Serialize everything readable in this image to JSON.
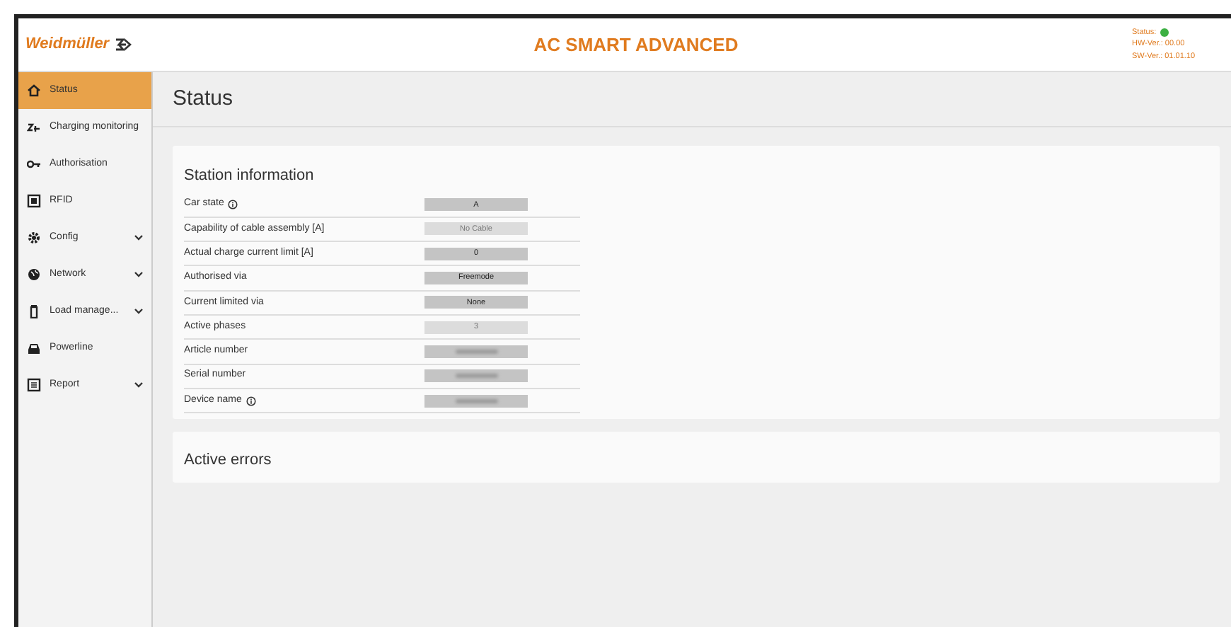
{
  "header": {
    "brand": "Weidmüller",
    "title": "AC SMART ADVANCED",
    "status_label": "Status:",
    "hw_version": "HW-Ver.: 00.00",
    "sw_version": "SW-Ver.: 01.01.10"
  },
  "sidebar": {
    "items": [
      {
        "label": "Status",
        "kind": "home",
        "selected": true,
        "expandable": false
      },
      {
        "label": "Charging monitoring",
        "kind": "plug",
        "selected": false,
        "expandable": false
      },
      {
        "label": "Authorisation",
        "kind": "key",
        "selected": false,
        "expandable": false
      },
      {
        "label": "RFID",
        "kind": "card",
        "selected": false,
        "expandable": false
      },
      {
        "label": "Config",
        "kind": "gear",
        "selected": false,
        "expandable": true
      },
      {
        "label": "Network",
        "kind": "globe",
        "selected": false,
        "expandable": true
      },
      {
        "label": "Load manage...",
        "kind": "pillar",
        "selected": false,
        "expandable": true
      },
      {
        "label": "Powerline",
        "kind": "car",
        "selected": false,
        "expandable": false
      },
      {
        "label": "Report",
        "kind": "report",
        "selected": false,
        "expandable": true
      }
    ]
  },
  "page_title": "Status",
  "station_information": {
    "title": "Station information",
    "rows": [
      {
        "label": "Car state",
        "info": true,
        "value": "A",
        "disabled": false
      },
      {
        "label": "Capability of cable assembly [A]",
        "info": false,
        "value": "No Cable",
        "disabled": true
      },
      {
        "label": "Actual charge current limit [A]",
        "info": false,
        "value": "0",
        "disabled": false
      },
      {
        "label": "Authorised via",
        "info": false,
        "value": "Freemode",
        "disabled": false
      },
      {
        "label": "Current limited via",
        "info": false,
        "value": "None",
        "disabled": false
      },
      {
        "label": "Active phases",
        "info": false,
        "value": "3",
        "disabled": true
      },
      {
        "label": "Article number",
        "info": false,
        "blurred": true,
        "disabled": false
      },
      {
        "label": "Serial number",
        "info": false,
        "blurred": true,
        "disabled": false
      },
      {
        "label": "Device name",
        "info": true,
        "blurred": true,
        "disabled": false
      }
    ]
  },
  "active_errors": {
    "title": "Active errors"
  }
}
